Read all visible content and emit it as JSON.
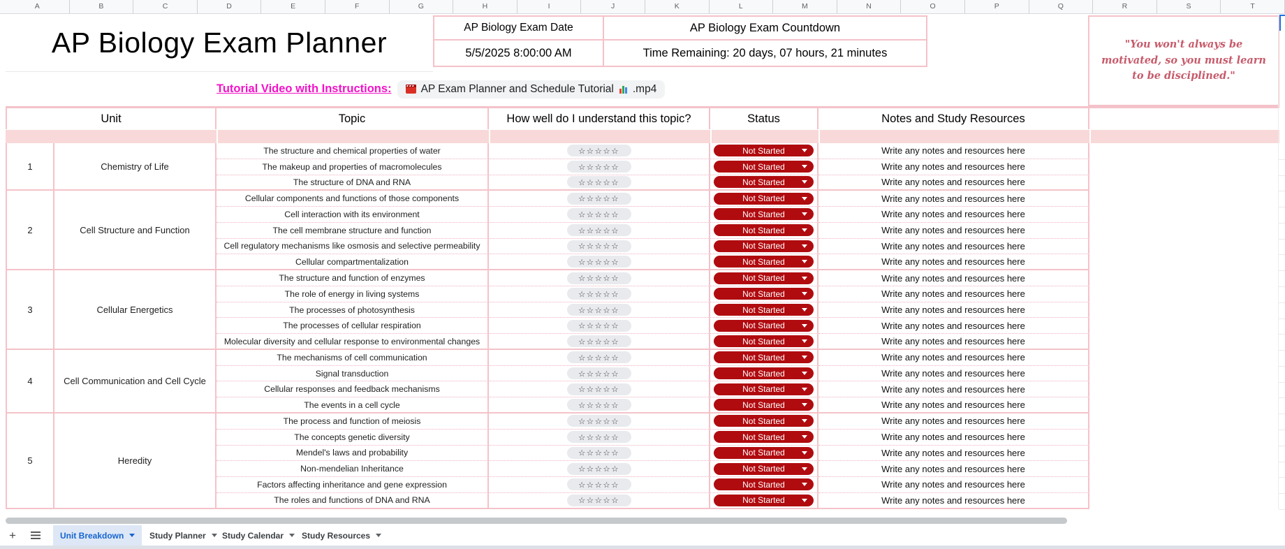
{
  "column_letters": [
    "A",
    "B",
    "C",
    "D",
    "E",
    "F",
    "G",
    "H",
    "I",
    "J",
    "K",
    "L",
    "M",
    "N",
    "O",
    "P",
    "Q",
    "R",
    "S",
    "T"
  ],
  "header": {
    "title": "AP Biology Exam Planner",
    "exam_date_label": "AP Biology Exam Date",
    "exam_date_value": "5/5/2025 8:00:00 AM",
    "countdown_label": "AP Biology Exam Countdown",
    "countdown_value": "Time Remaining: 20 days, 07 hours, 21 minutes",
    "quote": "\"You won't always be motivated, so you must learn to be disciplined.\""
  },
  "tutorial": {
    "label": "Tutorial Video with Instructions: ",
    "video_title": "AP Exam Planner and Schedule Tutorial",
    "video_ext": ".mp4",
    "icons": [
      "clapperboard-icon",
      "bar-chart-icon"
    ]
  },
  "table": {
    "headers": [
      "Unit",
      "Topic",
      "How well do I understand this topic?",
      "Status",
      "Notes and Study Resources"
    ],
    "rating_stars": "☆☆☆☆☆",
    "status_value": "Not Started",
    "notes_placeholder": "Write any notes and resources here",
    "units": [
      {
        "number": "1",
        "name": "Chemistry of Life",
        "topics": [
          "The structure and chemical properties of water",
          "The makeup and properties of macromolecules",
          "The structure of DNA and RNA"
        ]
      },
      {
        "number": "2",
        "name": "Cell Structure and Function",
        "topics": [
          "Cellular components and functions of those components",
          "Cell interaction with its environment",
          "The cell membrane structure and function",
          "Cell regulatory mechanisms like osmosis and selective permeability",
          "Cellular compartmentalization"
        ]
      },
      {
        "number": "3",
        "name": "Cellular Energetics",
        "topics": [
          "The structure and function of enzymes",
          "The role of energy in living systems",
          "The processes of photosynthesis",
          "The processes of cellular respiration",
          "Molecular diversity and cellular response to environmental changes"
        ]
      },
      {
        "number": "4",
        "name": "Cell Communication and Cell Cycle",
        "topics": [
          "The mechanisms of cell communication",
          "Signal transduction",
          "Cellular responses and feedback mechanisms",
          "The events in a cell cycle"
        ]
      },
      {
        "number": "5",
        "name": "Heredity",
        "topics": [
          "The process and function of meiosis",
          "The concepts genetic diversity",
          "Mendel's laws and probability",
          "Non-mendelian Inheritance",
          "Factors affecting inheritance and gene expression",
          "The roles and functions of DNA and RNA"
        ]
      }
    ]
  },
  "tabs": {
    "items": [
      {
        "label": "Unit Breakdown",
        "active": true
      },
      {
        "label": "Study Planner",
        "active": false
      },
      {
        "label": "Study Calendar",
        "active": false
      },
      {
        "label": "Study Resources",
        "active": false
      }
    ]
  },
  "colors": {
    "pink_border": "#F4C2C9",
    "pink_band": "#F8D8D8",
    "status_red": "#B00B0F",
    "link_magenta": "#F312C9",
    "tab_blue": "#1765CF",
    "tab_blue_bg": "#DDE7F6",
    "quote_rose": "#C75B6B",
    "star_pill": "#E9EAED"
  }
}
